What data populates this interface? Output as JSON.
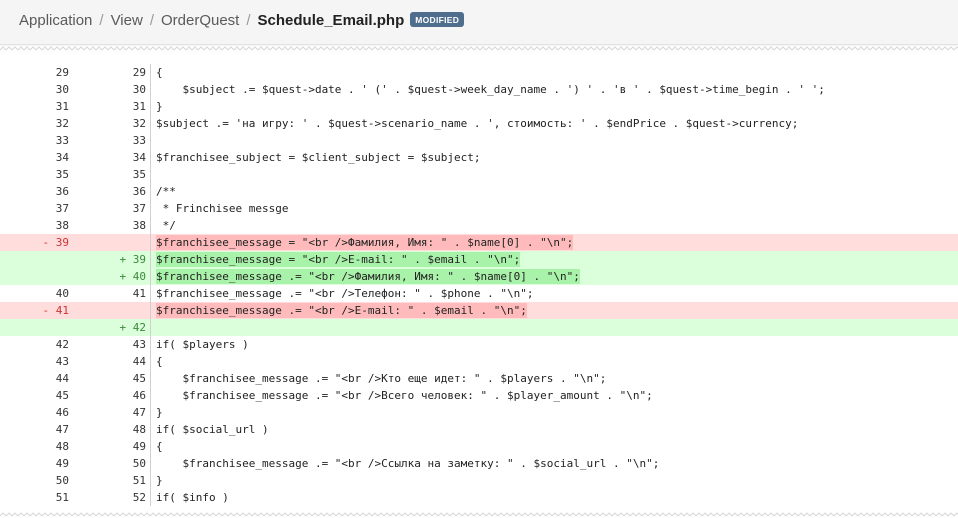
{
  "breadcrumb": {
    "items": [
      "Application",
      "View",
      "OrderQuest"
    ],
    "current": "Schedule_Email.php",
    "badge": "MODIFIED",
    "separator": "/"
  },
  "diff": {
    "rows": [
      {
        "type": "ctx",
        "old": "29",
        "new": "29",
        "code": "{"
      },
      {
        "type": "ctx",
        "old": "30",
        "new": "30",
        "code": "    $subject .= $quest->date . ' (' . $quest->week_day_name . ') ' . 'в ' . $quest->time_begin . ' ';"
      },
      {
        "type": "ctx",
        "old": "31",
        "new": "31",
        "code": "}"
      },
      {
        "type": "ctx",
        "old": "32",
        "new": "32",
        "code": "$subject .= 'на игру: ' . $quest->scenario_name . ', стоимость: ' . $endPrice . $quest->currency;"
      },
      {
        "type": "ctx",
        "old": "33",
        "new": "33",
        "code": ""
      },
      {
        "type": "ctx",
        "old": "34",
        "new": "34",
        "code": "$franchisee_subject = $client_subject = $subject;"
      },
      {
        "type": "ctx",
        "old": "35",
        "new": "35",
        "code": ""
      },
      {
        "type": "ctx",
        "old": "36",
        "new": "36",
        "code": "/**"
      },
      {
        "type": "ctx",
        "old": "37",
        "new": "37",
        "code": " * Frinchisee messge"
      },
      {
        "type": "ctx",
        "old": "38",
        "new": "38",
        "code": " */"
      },
      {
        "type": "del",
        "old": "- 39",
        "new": "",
        "code": "$franchisee_message = \"<br />Фамилия, Имя: \" . $name[0] . \"\\n\";"
      },
      {
        "type": "add",
        "old": "",
        "new": "+ 39",
        "code": "$franchisee_message = \"<br />E-mail: \" . $email . \"\\n\";"
      },
      {
        "type": "add",
        "old": "",
        "new": "+ 40",
        "code": "$franchisee_message .= \"<br />Фамилия, Имя: \" . $name[0] . \"\\n\";"
      },
      {
        "type": "ctx",
        "old": "40",
        "new": "41",
        "code": "$franchisee_message .= \"<br />Телефон: \" . $phone . \"\\n\";"
      },
      {
        "type": "del",
        "old": "- 41",
        "new": "",
        "code": "$franchisee_message .= \"<br />E-mail: \" . $email . \"\\n\";"
      },
      {
        "type": "add",
        "old": "",
        "new": "+ 42",
        "code": ""
      },
      {
        "type": "ctx",
        "old": "42",
        "new": "43",
        "code": "if( $players )"
      },
      {
        "type": "ctx",
        "old": "43",
        "new": "44",
        "code": "{"
      },
      {
        "type": "ctx",
        "old": "44",
        "new": "45",
        "code": "    $franchisee_message .= \"<br />Кто еще идет: \" . $players . \"\\n\";"
      },
      {
        "type": "ctx",
        "old": "45",
        "new": "46",
        "code": "    $franchisee_message .= \"<br />Всего человек: \" . $player_amount . \"\\n\";"
      },
      {
        "type": "ctx",
        "old": "46",
        "new": "47",
        "code": "}"
      },
      {
        "type": "ctx",
        "old": "47",
        "new": "48",
        "code": "if( $social_url )"
      },
      {
        "type": "ctx",
        "old": "48",
        "new": "49",
        "code": "{"
      },
      {
        "type": "ctx",
        "old": "49",
        "new": "50",
        "code": "    $franchisee_message .= \"<br />Ссылка на заметку: \" . $social_url . \"\\n\";"
      },
      {
        "type": "ctx",
        "old": "50",
        "new": "51",
        "code": "}"
      },
      {
        "type": "ctx",
        "old": "51",
        "new": "52",
        "code": "if( $info )"
      }
    ]
  },
  "colors": {
    "deleted_bg": "#ffdddd",
    "added_bg": "#dbffdb",
    "badge_bg": "#4f6d8c"
  }
}
